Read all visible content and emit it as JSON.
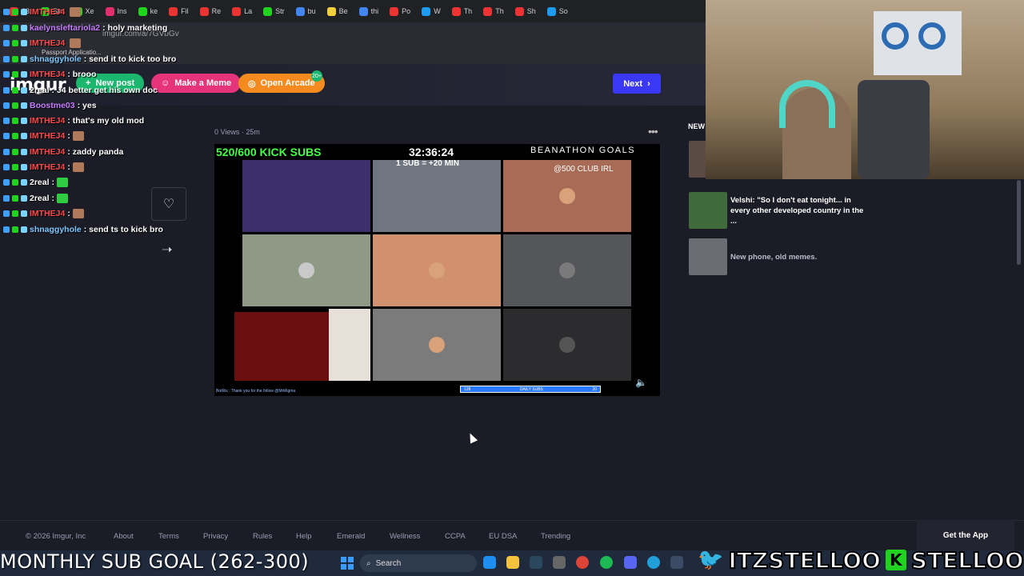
{
  "browser": {
    "tabs": [
      "23",
      "Str",
      "Xe",
      "Ins",
      "ke",
      "Fil",
      "Re",
      "La",
      "Str",
      "bu",
      "Be",
      "thi",
      "Po",
      "W",
      "Th",
      "Th",
      "Sh",
      "So"
    ],
    "url": "imgur.com/a/7GVbGv",
    "passport_label": "Passport Applicatio..."
  },
  "header": {
    "logo": "imgur",
    "new_post": "New post",
    "make_meme": "Make a Meme",
    "open_arcade": "Open Arcade",
    "arcade_badge": "20+",
    "next": "Next"
  },
  "chat": [
    {
      "user": "IMTHEJ4",
      "text": "",
      "color": "#ff4a4a",
      "emote": true
    },
    {
      "user": "kaelynsleftariola2",
      "text": ": holy marketing",
      "color": "#c77dff",
      "emote": false
    },
    {
      "user": "IMTHEJ4",
      "text": "",
      "color": "#ff4a4a",
      "emote": true
    },
    {
      "user": "shnaggyhole",
      "text": ": send it to kick too bro",
      "color": "#7ec8ff",
      "emote": false
    },
    {
      "user": "IMTHEJ4",
      "text": ": brooo",
      "color": "#ff4a4a",
      "emote": false
    },
    {
      "user": "2real",
      "text": ": J4 better get his own doc",
      "color": "#ffffff",
      "emote": false
    },
    {
      "user": "Boostme03",
      "text": ": yes",
      "color": "#c77dff",
      "emote": false
    },
    {
      "user": "IMTHEJ4",
      "text": ": that's my old mod",
      "color": "#ff4a4a",
      "emote": false
    },
    {
      "user": "IMTHEJ4",
      "text": ":",
      "color": "#ff4a4a",
      "emote": true
    },
    {
      "user": "IMTHEJ4",
      "text": ": zaddy panda",
      "color": "#ff4a4a",
      "emote": false
    },
    {
      "user": "IMTHEJ4",
      "text": ":",
      "color": "#ff4a4a",
      "emote": true
    },
    {
      "user": "2real",
      "text": ":",
      "color": "#ffffff",
      "emote": true
    },
    {
      "user": "2real",
      "text": ":",
      "color": "#ffffff",
      "emote": true
    },
    {
      "user": "IMTHEJ4",
      "text": ":",
      "color": "#ff4a4a",
      "emote": true
    },
    {
      "user": "shnaggyhole",
      "text": ": send ts to kick bro",
      "color": "#7ec8ff",
      "emote": false
    }
  ],
  "post": {
    "meta": "0 Views · 25m"
  },
  "video": {
    "subs": "520/600 KICK SUBS",
    "timer": "32:36:24",
    "goals": "BEANATHON GOALS",
    "sub_time": "1 SUB = +20 MIN",
    "club": "@500 CLUB IRL",
    "bot_line": "BotRix : Thank you for the follow @MrMigma",
    "daily_left": "128",
    "daily_label": "DAILY SUBS",
    "daily_right": "20"
  },
  "sidebar": {
    "new_label": "NEW",
    "items": [
      {
        "title": ""
      },
      {
        "title": "Velshi: \"So I don't eat tonight... in every other developed country in the ..."
      },
      {
        "title": "New phone, old memes."
      }
    ]
  },
  "footer": {
    "copyright": "© 2026 Imgur, Inc",
    "links": [
      "About",
      "Terms",
      "Privacy",
      "Rules",
      "Help",
      "Emerald",
      "Wellness",
      "CCPA",
      "EU DSA",
      "Trending"
    ],
    "get_app": "Get the App"
  },
  "overlay": {
    "sub_goal": "MONTHLY SUB GOAL (262-300)",
    "twitter_handle": "ITZSTELLOO",
    "kick_handle": "STELLOOO"
  },
  "taskbar": {
    "search": "Search"
  },
  "colors": {
    "accent": "#3b38f5",
    "new_post": "#1bb76e",
    "meme": "#e6347a",
    "arcade": "#f58b1f",
    "kick_green": "#47ff47"
  }
}
